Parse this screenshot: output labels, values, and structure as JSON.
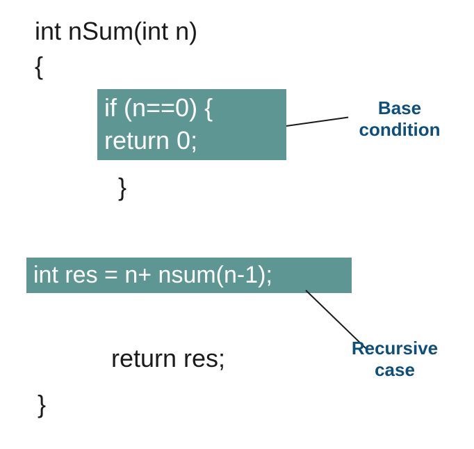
{
  "code": {
    "function_signature": "int nSum(int n)",
    "brace_open": "{",
    "base_condition_line1": "if (n==0) {",
    "base_condition_line2": "return 0;",
    "brace_close_inner": "}",
    "recursive_case": "int res = n+ nsum(n-1);",
    "return_statement": "return res;",
    "brace_close_outer": "}"
  },
  "labels": {
    "base_condition": "Base condition",
    "recursive_case": "Recursive case"
  },
  "colors": {
    "highlight_bg": "#5e9693",
    "label_color": "#0d4f7a",
    "code_color": "#1a1a1a"
  }
}
